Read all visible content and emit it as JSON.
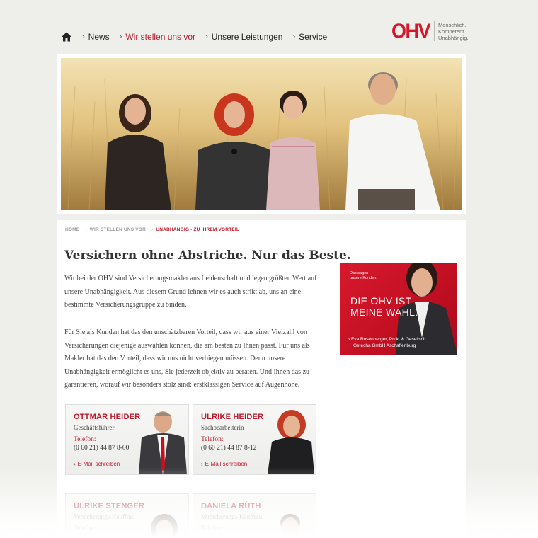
{
  "nav": {
    "home_icon": "home-icon",
    "items": [
      {
        "label": "News",
        "active": false
      },
      {
        "label": "Wir stellen uns vor",
        "active": true
      },
      {
        "label": "Unsere Leistungen",
        "active": false
      },
      {
        "label": "Service",
        "active": false
      }
    ]
  },
  "logo": {
    "mark": "OHV",
    "tagline": [
      "Menschlich.",
      "Kompetent.",
      "Unabhängig."
    ]
  },
  "breadcrumb": [
    "HOME",
    "WIR STELLEN UNS VOR",
    "UNABHÄNGIG - ZU IHREM VORTEIL"
  ],
  "page": {
    "title": "Versichern ohne Abstriche. Nur das Beste.",
    "paragraph1": "Wir bei der OHV sind Versicherungsmakler aus Leidenschaft und legen größten Wert auf unsere Unabhängigkeit. Aus diesem Grund lehnen wir es auch strikt ab, uns an eine bestimmte Versicherungsgruppe zu binden.",
    "paragraph2": "Für Sie als Kunden hat das den unschätzbaren Vorteil, dass wir aus einer Vielzahl von Versicherungen diejenige auswählen können, die am besten zu Ihnen passt. Für uns als Makler hat das den Vorteil, dass wir uns nicht verbiegen müssen. Denn unsere Unabhängigkeit ermöglicht es uns, Sie jederzeit objektiv zu beraten. Und Ihnen das zu garantieren, worauf wir besonders stolz sind: erstklassigen Service auf Augenhöhe."
  },
  "ad": {
    "small_line1": "Das sagen",
    "small_line2": "unsere Kunden:",
    "headline1": "DIE OHV IST",
    "headline2": "MEINE WAHL.",
    "footer1": "Eva Rosenberger, Prok. & Gesellsch.",
    "footer2": "Getecha GmbH Aschaffenburg"
  },
  "contacts": [
    {
      "name": "OTTMAR HEIDER",
      "role": "Geschäftsführer",
      "tel_label": "Telefon:",
      "tel": "(0 60 21) 44 87 8-00",
      "mail": "E-Mail schreiben"
    },
    {
      "name": "ULRIKE HEIDER",
      "role": "Sachbearbeiterin",
      "tel_label": "Telefon:",
      "tel": "(0 60 21) 44 87 8-12",
      "mail": "E-Mail schreiben"
    },
    {
      "name": "ULRIKE STENGER",
      "role": "Versicherungs-Kauffrau",
      "tel_label": "Telefon:",
      "tel": "",
      "mail": ""
    },
    {
      "name": "DANIELA RÜTH",
      "role": "Versicherungs-Kauffrau",
      "tel_label": "Telefon:",
      "tel": "",
      "mail": ""
    }
  ],
  "colors": {
    "brand_red": "#c0182b",
    "logo_red": "#d6172a",
    "page_bg": "#eeeeea"
  }
}
